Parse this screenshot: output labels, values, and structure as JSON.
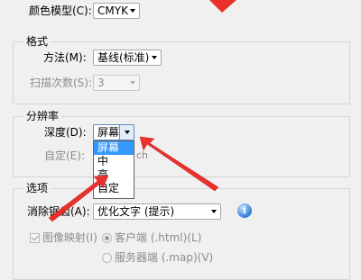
{
  "color_mode": {
    "label": "颜色模型(C):",
    "value": "CMYK"
  },
  "format": {
    "legend": "格式",
    "method_label": "方法(M):",
    "method_value": "基线(标准)",
    "scans_label": "扫描次数(S):",
    "scans_value": "3"
  },
  "resolution": {
    "legend": "分辨率",
    "depth_label": "深度(D):",
    "depth_value": "屏幕",
    "custom_label": "自定(E):",
    "custom_suffix": "ch",
    "options": [
      "屏幕",
      "中",
      "高",
      "自定"
    ]
  },
  "options_group": {
    "legend": "选项",
    "antialias_label": "消除锯齿(A):",
    "antialias_value": "优化文字 (提示)",
    "image_map_label": "图像映射(I)",
    "client_side_label": "客户端 (.html)(L)",
    "server_side_label": "服务器端 (.map)(V)"
  },
  "icons": {
    "info": "info-icon",
    "annotation": "red-arrow"
  },
  "colors": {
    "arrow": "#e8312a",
    "selection": "#3399ff"
  }
}
